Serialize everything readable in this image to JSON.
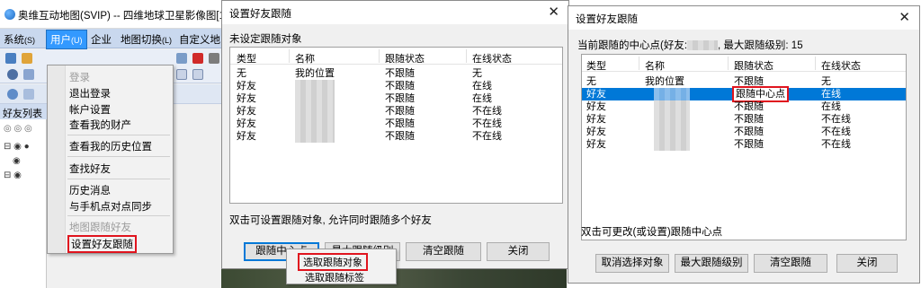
{
  "app": {
    "title": "奥维互动地图(SVIP) -- 四维地球卫星影像图[14] [罗",
    "menubar": [
      {
        "label": "系统",
        "key": "(S)"
      },
      {
        "label": "用户",
        "key": "(U)"
      },
      {
        "label": "企业",
        "key": ""
      },
      {
        "label": "地图切换",
        "key": "(L)"
      },
      {
        "label": "自定义地",
        "key": ""
      }
    ],
    "left_pane_title": "好友列表",
    "user_menu": {
      "items": [
        {
          "label": "登录",
          "disabled": true
        },
        {
          "label": "退出登录"
        },
        {
          "label": "帐户设置"
        },
        {
          "label": "查看我的财产"
        },
        {
          "label": "查看我的历史位置"
        },
        {
          "label": "查找好友"
        },
        {
          "label": "历史消息"
        },
        {
          "label": "与手机点对点同步"
        },
        {
          "label": "地图跟随好友",
          "disabled": true
        },
        {
          "label": "设置好友跟随",
          "highlighted": true
        }
      ]
    }
  },
  "dialog1": {
    "title": "设置好友跟随",
    "close_glyph": "✕",
    "status": "未设定跟随对象",
    "columns": [
      "类型",
      "名称",
      "跟随状态",
      "在线状态"
    ],
    "rows": [
      {
        "type": "无",
        "name": "我的位置",
        "follow": "不跟随",
        "online": "无"
      },
      {
        "type": "好友",
        "name": "",
        "follow": "不跟随",
        "online": "在线"
      },
      {
        "type": "好友",
        "name": "",
        "follow": "不跟随",
        "online": "在线"
      },
      {
        "type": "好友",
        "name": "",
        "follow": "不跟随",
        "online": "不在线"
      },
      {
        "type": "好友",
        "name": "",
        "follow": "不跟随",
        "online": "不在线"
      },
      {
        "type": "好友",
        "name": "",
        "follow": "不跟随",
        "online": "不在线"
      }
    ],
    "hint": "双击可设置跟随对象, 允许同时跟随多个好友",
    "buttons": [
      "跟随中心点",
      "最大跟随级别",
      "清空跟随",
      "关闭"
    ],
    "popup": [
      "选取跟随对象",
      "选取跟随标签"
    ]
  },
  "dialog2": {
    "title": "设置好友跟随",
    "close_glyph": "✕",
    "status": "当前跟随的中心点(好友:",
    "status_suffix": ", 最大跟随级别: 15",
    "columns": [
      "类型",
      "名称",
      "跟随状态",
      "在线状态"
    ],
    "rows": [
      {
        "type": "无",
        "name": "我的位置",
        "follow": "不跟随",
        "online": "无"
      },
      {
        "type": "好友",
        "name": "",
        "follow": "跟随中心点",
        "online": "在线",
        "selected": true
      },
      {
        "type": "好友",
        "name": "",
        "follow": "不跟随",
        "online": "在线"
      },
      {
        "type": "好友",
        "name": "",
        "follow": "不跟随",
        "online": "不在线"
      },
      {
        "type": "好友",
        "name": "",
        "follow": "不跟随",
        "online": "不在线"
      },
      {
        "type": "好友",
        "name": "",
        "follow": "不跟随",
        "online": "不在线"
      }
    ],
    "hint": "双击可更改(或设置)跟随中心点",
    "buttons": [
      "取消选择对象",
      "最大跟随级别",
      "清空跟随",
      "关闭"
    ]
  },
  "colors": {
    "highlight_box": "#e0141e",
    "selection": "#0078d7",
    "menubar": "#c9d8ee"
  }
}
